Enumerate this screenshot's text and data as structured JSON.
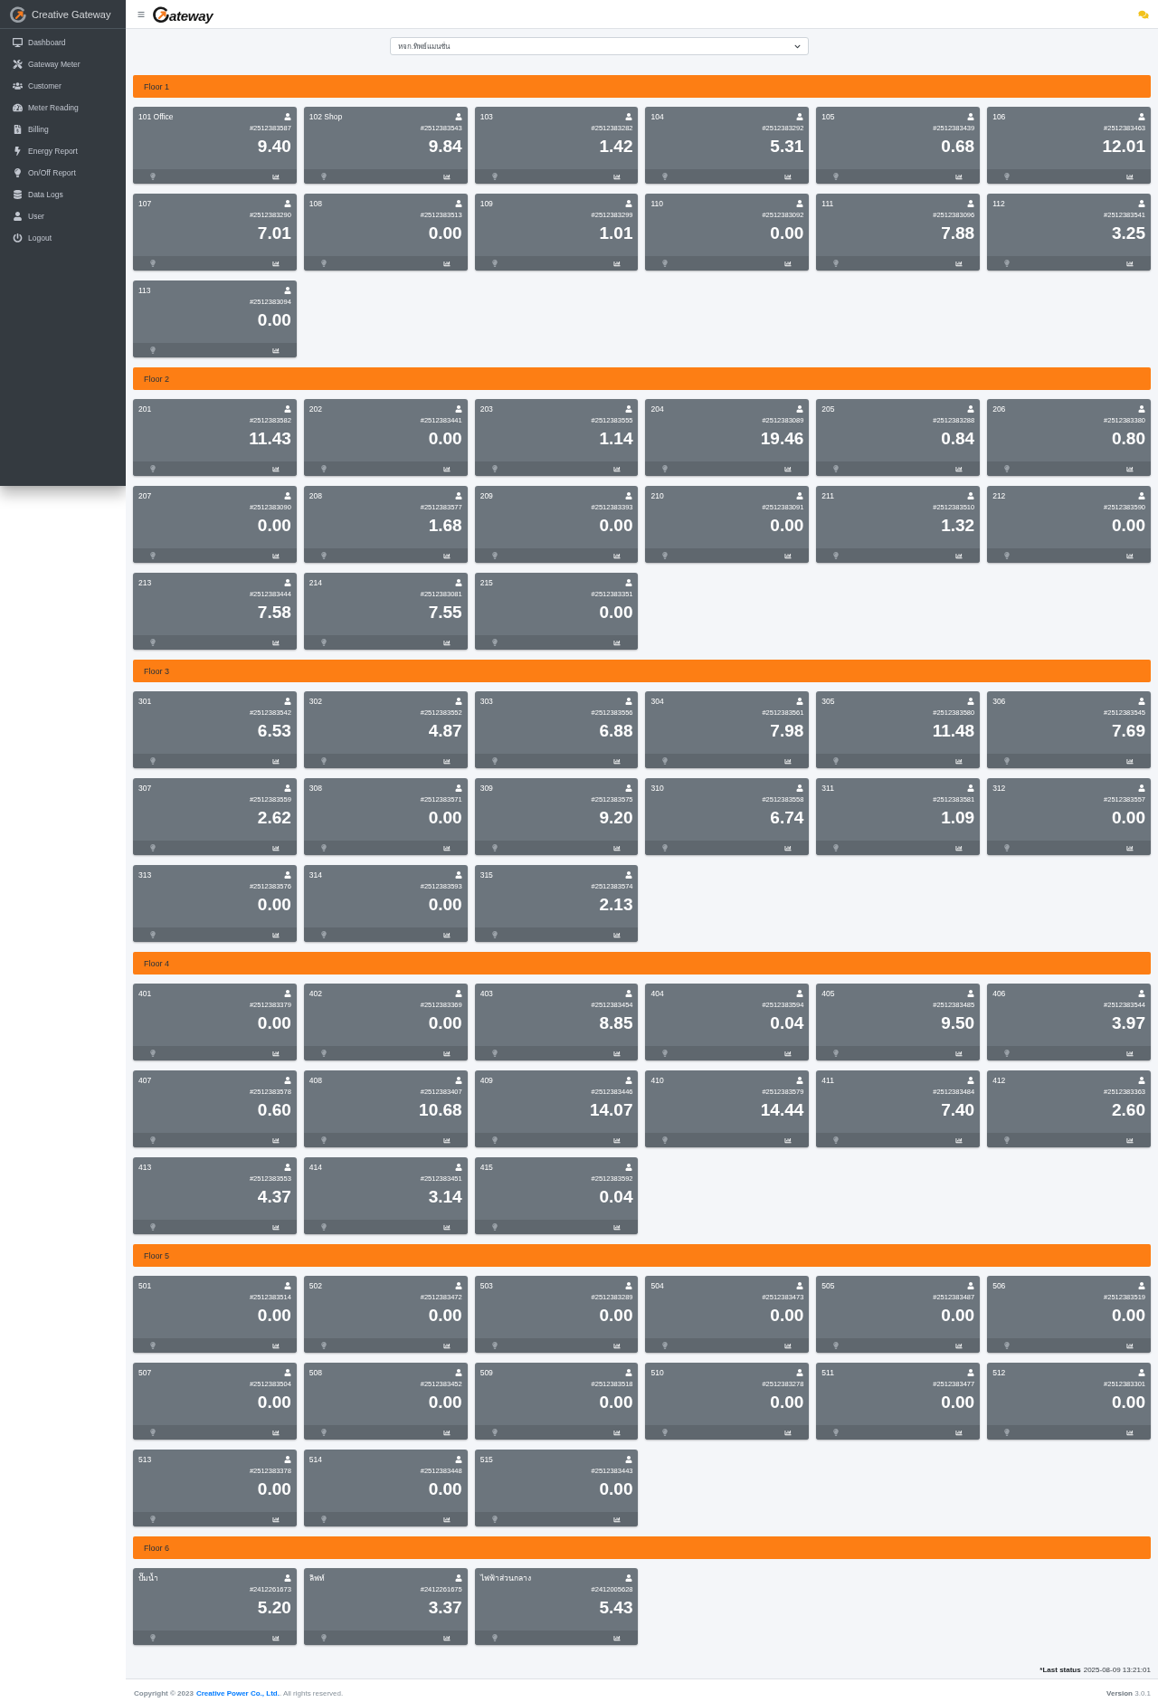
{
  "sidebar": {
    "brand": "Creative Gateway",
    "menu": [
      {
        "label": "Dashboard",
        "selected": false
      },
      {
        "label": "Gateway Meter",
        "selected": false
      },
      {
        "label": "Customer",
        "selected": false
      },
      {
        "label": "Meter Reading",
        "selected": false
      },
      {
        "label": "Billing",
        "selected": false
      },
      {
        "label": "Energy Report",
        "selected": false
      },
      {
        "label": "On/Off Report",
        "selected": false
      },
      {
        "label": "Data Logs",
        "selected": false
      },
      {
        "label": "User",
        "selected": false
      },
      {
        "label": "Logout",
        "selected": false
      }
    ]
  },
  "header": {
    "logo_text": "ateway"
  },
  "building_select": {
    "value": "หจก.ทิพย์แมนชั่น"
  },
  "floors": [
    {
      "title": "Floor 1",
      "meters": [
        {
          "name": "101 Office",
          "meter_id": "#2512383587",
          "reading": "9.40"
        },
        {
          "name": "102 Shop",
          "meter_id": "#2512383543",
          "reading": "9.84"
        },
        {
          "name": "103",
          "meter_id": "#2512383282",
          "reading": "1.42"
        },
        {
          "name": "104",
          "meter_id": "#2512383292",
          "reading": "5.31"
        },
        {
          "name": "105",
          "meter_id": "#2512383439",
          "reading": "0.68"
        },
        {
          "name": "106",
          "meter_id": "#2512383463",
          "reading": "12.01"
        },
        {
          "name": "107",
          "meter_id": "#2512383290",
          "reading": "7.01"
        },
        {
          "name": "108",
          "meter_id": "#2512383513",
          "reading": "0.00"
        },
        {
          "name": "109",
          "meter_id": "#2512383299",
          "reading": "1.01"
        },
        {
          "name": "110",
          "meter_id": "#2512383092",
          "reading": "0.00"
        },
        {
          "name": "111",
          "meter_id": "#2512383096",
          "reading": "7.88"
        },
        {
          "name": "112",
          "meter_id": "#2512383541",
          "reading": "3.25"
        },
        {
          "name": "113",
          "meter_id": "#2512383094",
          "reading": "0.00"
        }
      ]
    },
    {
      "title": "Floor 2",
      "meters": [
        {
          "name": "201",
          "meter_id": "#2512383582",
          "reading": "11.43"
        },
        {
          "name": "202",
          "meter_id": "#2512383441",
          "reading": "0.00"
        },
        {
          "name": "203",
          "meter_id": "#2512383555",
          "reading": "1.14"
        },
        {
          "name": "204",
          "meter_id": "#2512383089",
          "reading": "19.46"
        },
        {
          "name": "205",
          "meter_id": "#2512383288",
          "reading": "0.84"
        },
        {
          "name": "206",
          "meter_id": "#2512383380",
          "reading": "0.80"
        },
        {
          "name": "207",
          "meter_id": "#2512383090",
          "reading": "0.00"
        },
        {
          "name": "208",
          "meter_id": "#2512383577",
          "reading": "1.68"
        },
        {
          "name": "209",
          "meter_id": "#2512383393",
          "reading": "0.00"
        },
        {
          "name": "210",
          "meter_id": "#2512383091",
          "reading": "0.00"
        },
        {
          "name": "211",
          "meter_id": "#2512383510",
          "reading": "1.32"
        },
        {
          "name": "212",
          "meter_id": "#2512383590",
          "reading": "0.00"
        },
        {
          "name": "213",
          "meter_id": "#2512383444",
          "reading": "7.58"
        },
        {
          "name": "214",
          "meter_id": "#2512383081",
          "reading": "7.55"
        },
        {
          "name": "215",
          "meter_id": "#2512383351",
          "reading": "0.00"
        }
      ]
    },
    {
      "title": "Floor 3",
      "meters": [
        {
          "name": "301",
          "meter_id": "#2512383542",
          "reading": "6.53"
        },
        {
          "name": "302",
          "meter_id": "#2512383552",
          "reading": "4.87"
        },
        {
          "name": "303",
          "meter_id": "#2512383556",
          "reading": "6.88"
        },
        {
          "name": "304",
          "meter_id": "#2512383561",
          "reading": "7.98"
        },
        {
          "name": "305",
          "meter_id": "#2512383580",
          "reading": "11.48"
        },
        {
          "name": "306",
          "meter_id": "#2512383545",
          "reading": "7.69"
        },
        {
          "name": "307",
          "meter_id": "#2512383559",
          "reading": "2.62"
        },
        {
          "name": "308",
          "meter_id": "#2512383571",
          "reading": "0.00"
        },
        {
          "name": "309",
          "meter_id": "#2512383575",
          "reading": "9.20"
        },
        {
          "name": "310",
          "meter_id": "#2512383558",
          "reading": "6.74"
        },
        {
          "name": "311",
          "meter_id": "#2512383581",
          "reading": "1.09"
        },
        {
          "name": "312",
          "meter_id": "#2512383557",
          "reading": "0.00"
        },
        {
          "name": "313",
          "meter_id": "#2512383576",
          "reading": "0.00"
        },
        {
          "name": "314",
          "meter_id": "#2512383593",
          "reading": "0.00"
        },
        {
          "name": "315",
          "meter_id": "#2512383574",
          "reading": "2.13"
        }
      ]
    },
    {
      "title": "Floor 4",
      "meters": [
        {
          "name": "401",
          "meter_id": "#2512383379",
          "reading": "0.00"
        },
        {
          "name": "402",
          "meter_id": "#2512383369",
          "reading": "0.00"
        },
        {
          "name": "403",
          "meter_id": "#2512383454",
          "reading": "8.85"
        },
        {
          "name": "404",
          "meter_id": "#2512383594",
          "reading": "0.04"
        },
        {
          "name": "405",
          "meter_id": "#2512383485",
          "reading": "9.50"
        },
        {
          "name": "406",
          "meter_id": "#2512383544",
          "reading": "3.97"
        },
        {
          "name": "407",
          "meter_id": "#2512383578",
          "reading": "0.60"
        },
        {
          "name": "408",
          "meter_id": "#2512383407",
          "reading": "10.68"
        },
        {
          "name": "409",
          "meter_id": "#2512383446",
          "reading": "14.07"
        },
        {
          "name": "410",
          "meter_id": "#2512383579",
          "reading": "14.44"
        },
        {
          "name": "411",
          "meter_id": "#2512383484",
          "reading": "7.40"
        },
        {
          "name": "412",
          "meter_id": "#2512383363",
          "reading": "2.60"
        },
        {
          "name": "413",
          "meter_id": "#2512383553",
          "reading": "4.37"
        },
        {
          "name": "414",
          "meter_id": "#2512383451",
          "reading": "3.14"
        },
        {
          "name": "415",
          "meter_id": "#2512383592",
          "reading": "0.04"
        }
      ]
    },
    {
      "title": "Floor 5",
      "meters": [
        {
          "name": "501",
          "meter_id": "#2512383514",
          "reading": "0.00"
        },
        {
          "name": "502",
          "meter_id": "#2512383472",
          "reading": "0.00"
        },
        {
          "name": "503",
          "meter_id": "#2512383289",
          "reading": "0.00"
        },
        {
          "name": "504",
          "meter_id": "#2512383473",
          "reading": "0.00"
        },
        {
          "name": "505",
          "meter_id": "#2512383487",
          "reading": "0.00"
        },
        {
          "name": "506",
          "meter_id": "#2512383519",
          "reading": "0.00"
        },
        {
          "name": "507",
          "meter_id": "#2512383504",
          "reading": "0.00"
        },
        {
          "name": "508",
          "meter_id": "#2512383452",
          "reading": "0.00"
        },
        {
          "name": "509",
          "meter_id": "#2512383518",
          "reading": "0.00"
        },
        {
          "name": "510",
          "meter_id": "#2512383278",
          "reading": "0.00"
        },
        {
          "name": "511",
          "meter_id": "#2512383477",
          "reading": "0.00"
        },
        {
          "name": "512",
          "meter_id": "#2512383301",
          "reading": "0.00"
        },
        {
          "name": "513",
          "meter_id": "#2512383378",
          "reading": "0.00"
        },
        {
          "name": "514",
          "meter_id": "#2512383448",
          "reading": "0.00"
        },
        {
          "name": "515",
          "meter_id": "#2512383443",
          "reading": "0.00"
        }
      ]
    },
    {
      "title": "Floor 6",
      "meters": [
        {
          "name": "ปั๊มน้ำ",
          "meter_id": "#2412261673",
          "reading": "5.20"
        },
        {
          "name": "ลิฟท์",
          "meter_id": "#2412261675",
          "reading": "3.37"
        },
        {
          "name": "ไฟฟ้าส่วนกลาง",
          "meter_id": "#2412005628",
          "reading": "5.43"
        }
      ]
    }
  ],
  "last_status": {
    "label": "*Last status",
    "time": "2025-08-09 13:21:01"
  },
  "footer": {
    "copyright": "Copyright © 2023",
    "company": "Creative Power Co., Ltd.",
    "rights": ". All rights reserved.",
    "version": "**Version** 3.0.1"
  }
}
